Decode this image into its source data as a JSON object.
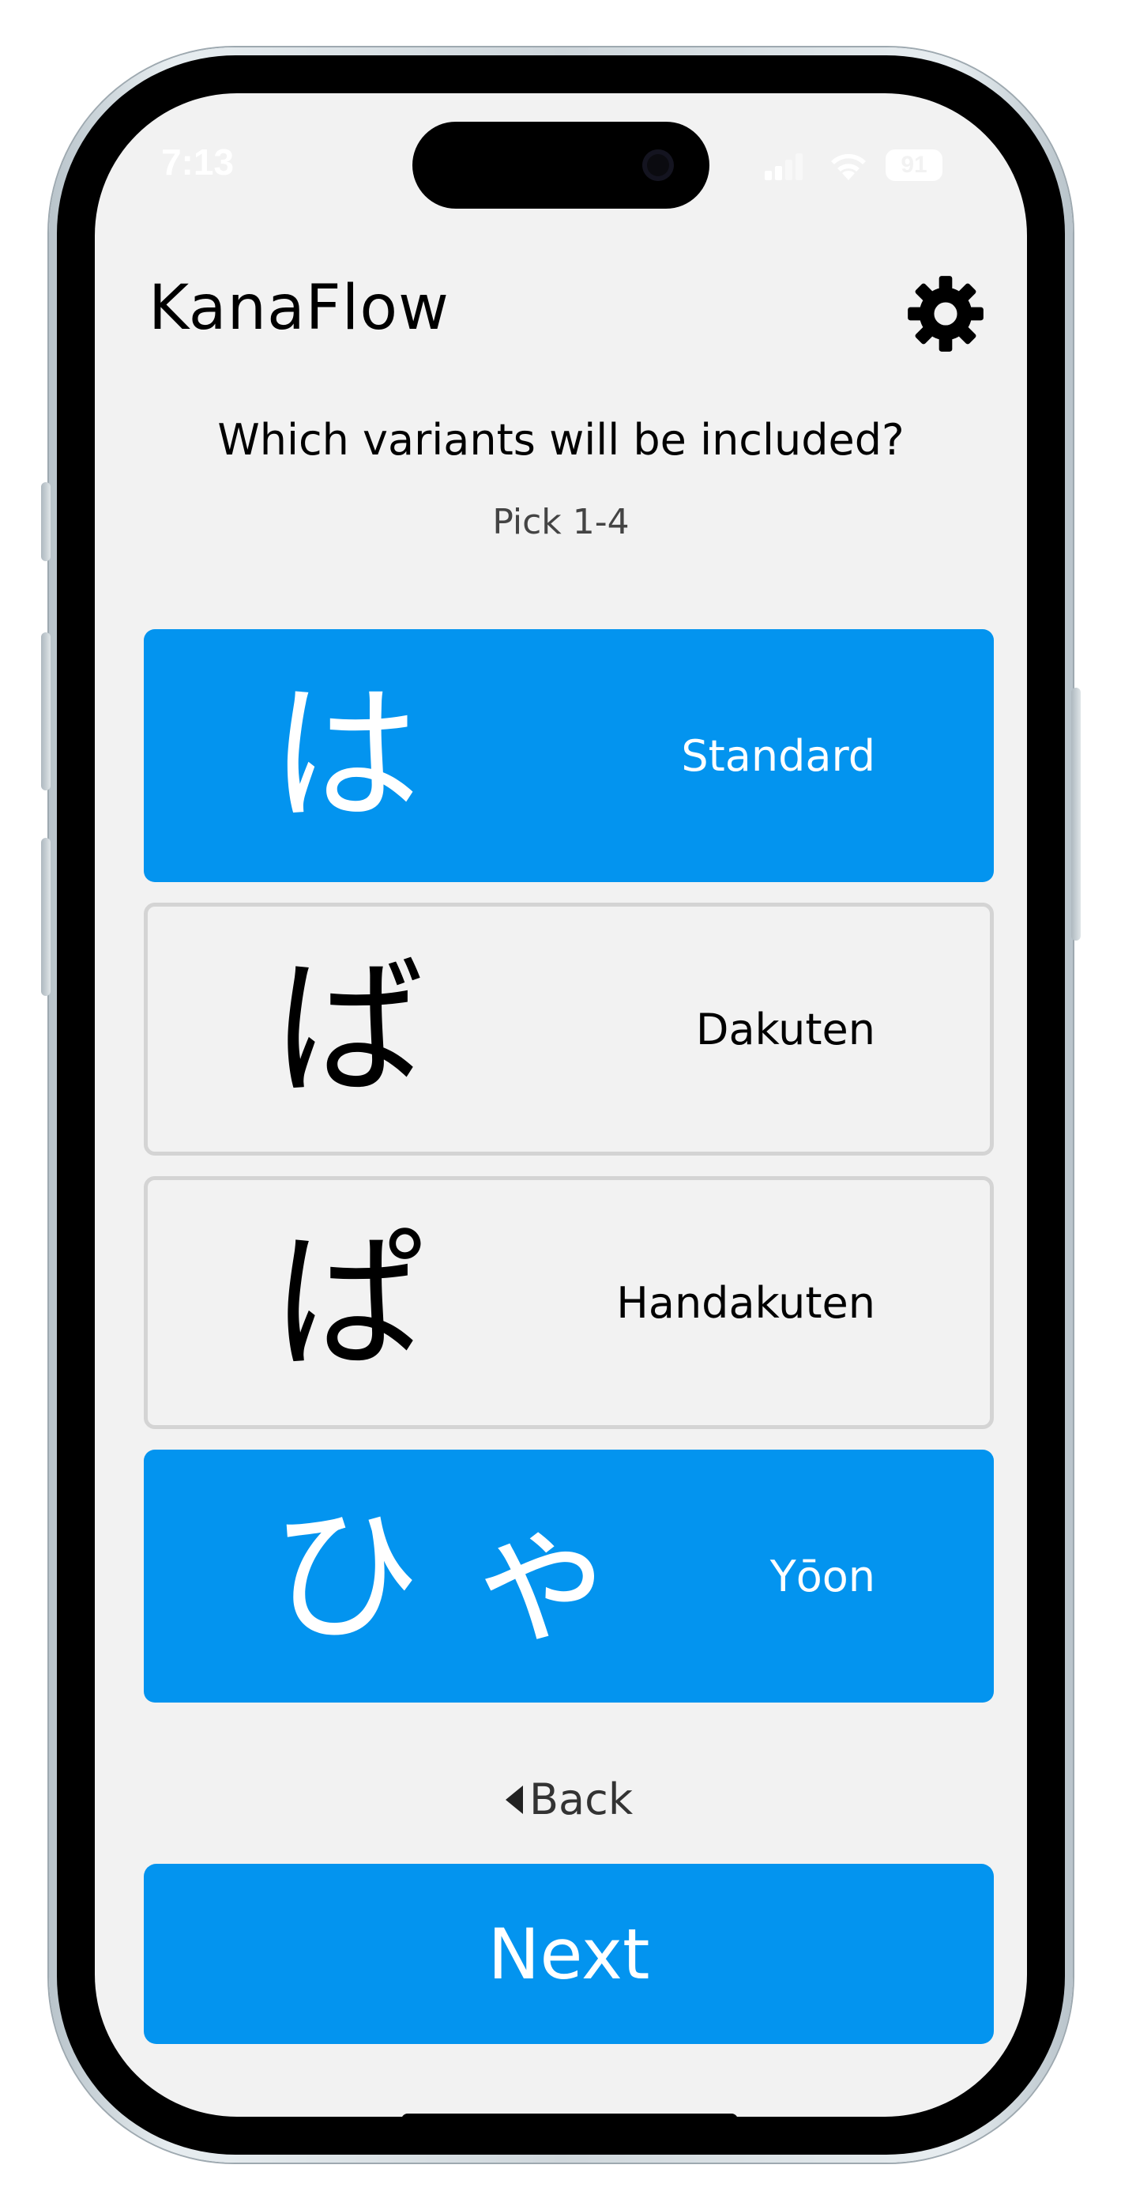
{
  "status_bar": {
    "time": "7:13",
    "battery": "91"
  },
  "header": {
    "title": "KanaFlow",
    "settings_icon": "gear-icon"
  },
  "prompt": {
    "question": "Which variants will be included?",
    "hint": "Pick 1-4"
  },
  "variants": [
    {
      "kana": "は",
      "label": "Standard",
      "selected": true
    },
    {
      "kana": "ば",
      "label": "Dakuten",
      "selected": false
    },
    {
      "kana": "ぱ",
      "label": "Handakuten",
      "selected": false
    },
    {
      "kana": "ひ ゃ",
      "label": "Yōon",
      "selected": true
    }
  ],
  "nav": {
    "back_label": "Back",
    "back_icon": "caret-left-icon",
    "next_label": "Next"
  },
  "colors": {
    "accent": "#0394ef",
    "background": "#f2f2f2",
    "unselected_border": "#d4d4d4"
  }
}
